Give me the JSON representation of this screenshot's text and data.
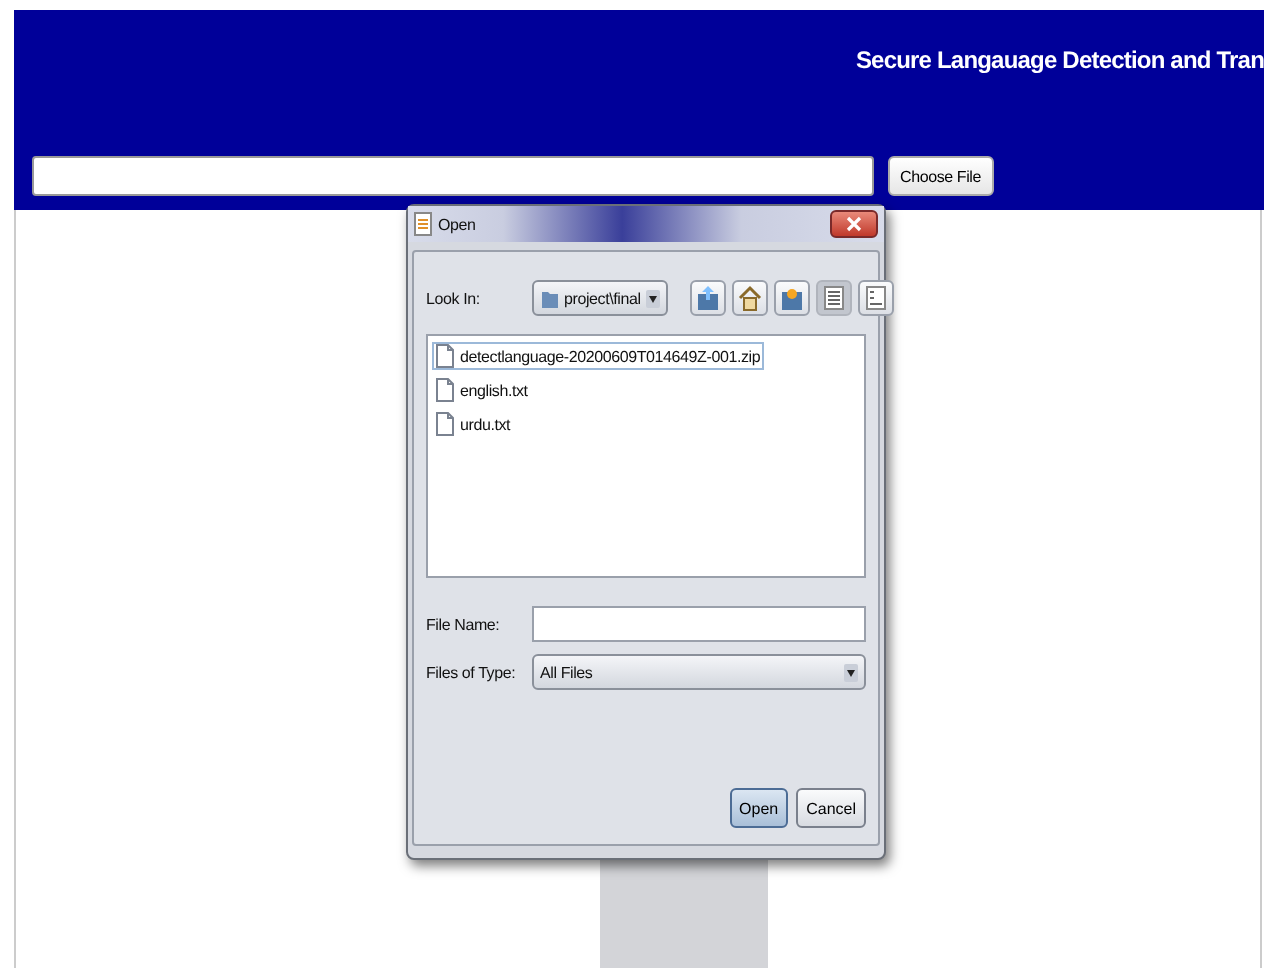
{
  "header": {
    "title": "Secure Langauage Detection and Tran"
  },
  "upload": {
    "button": "Choose File"
  },
  "dialog": {
    "title": "Open",
    "look_in": {
      "label": "Look In:",
      "value": "project\\final"
    },
    "toolbar": [
      {
        "kind": "up",
        "selected": false
      },
      {
        "kind": "home",
        "selected": false
      },
      {
        "kind": "new-folder",
        "selected": false
      },
      {
        "kind": "list",
        "selected": true
      },
      {
        "kind": "details",
        "selected": false
      }
    ],
    "files": [
      {
        "name": "detectlanguage-20200609T014649Z-001.zip",
        "selected": true
      },
      {
        "name": "english.txt",
        "selected": false
      },
      {
        "name": "urdu.txt",
        "selected": false
      }
    ],
    "file_name": {
      "label": "File Name:"
    },
    "file_type": {
      "label": "Files of Type:",
      "value": "All Files"
    },
    "buttons": [
      {
        "label": "Open",
        "default": true
      },
      {
        "label": "Cancel",
        "default": false
      }
    ]
  }
}
